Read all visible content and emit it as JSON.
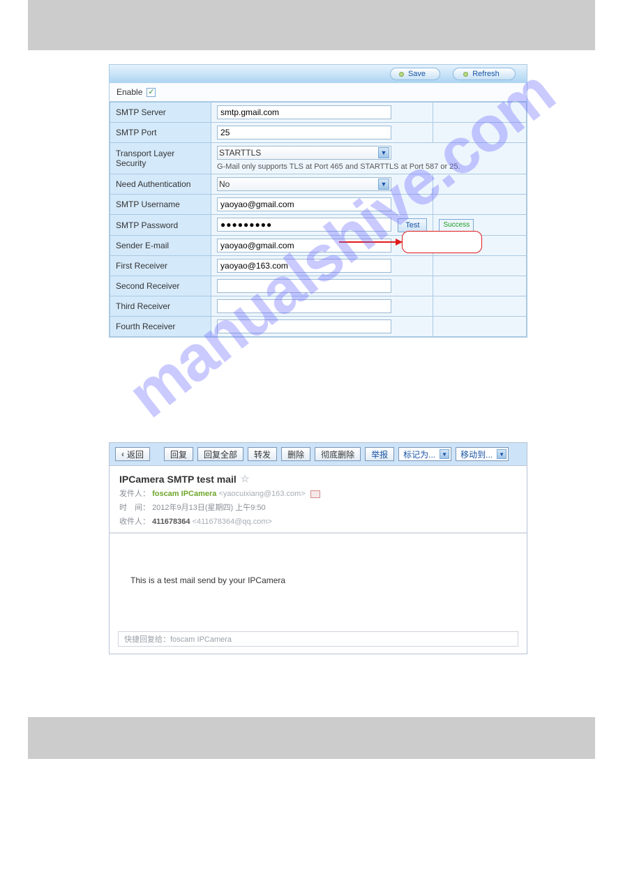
{
  "smtp": {
    "save_label": "Save",
    "refresh_label": "Refresh",
    "enable_label": "Enable",
    "rows": {
      "server": {
        "label": "SMTP Server",
        "value": "smtp.gmail.com"
      },
      "port": {
        "label": "SMTP Port",
        "value": "25"
      },
      "tls": {
        "label": "Transport Layer Security",
        "value": "STARTTLS",
        "hint": "G-Mail only supports TLS at Port 465 and STARTTLS at Port 587 or 25."
      },
      "auth": {
        "label": "Need Authentication",
        "value": "No"
      },
      "user": {
        "label": "SMTP Username",
        "value": "yaoyao@gmail.com"
      },
      "pass": {
        "label": "SMTP Password",
        "value": "●●●●●●●●●",
        "test_label": "Test",
        "success_label": "Success"
      },
      "sender": {
        "label": "Sender E-mail",
        "value": "yaoyao@gmail.com"
      },
      "r1": {
        "label": "First Receiver",
        "value": "yaoyao@163.com"
      },
      "r2": {
        "label": "Second Receiver",
        "value": ""
      },
      "r3": {
        "label": "Third Receiver",
        "value": ""
      },
      "r4": {
        "label": "Fourth Receiver",
        "value": ""
      }
    }
  },
  "mail": {
    "toolbar": {
      "back": "返回",
      "reply": "回复",
      "reply_all": "回复全部",
      "forward": "转发",
      "delete": "删除",
      "delete_forever": "彻底删除",
      "report": "举报",
      "mark_as": "标记为...",
      "move_to": "移动到..."
    },
    "subject": "IPCamera SMTP test mail",
    "from_label": "发件人：",
    "from_name": "foscam IPCamera",
    "from_addr": "<yaocuixiang@163.com>",
    "time_label": "时　间：",
    "time_value": "2012年9月13日(星期四) 上午9:50",
    "to_label": "收件人：",
    "to_name": "411678364",
    "to_addr": "<411678364@qq.com>",
    "body": "This is a test mail send by your IPCamera",
    "quick_reply": "快捷回复给：foscam IPCamera"
  },
  "watermark": "manualshive.com"
}
